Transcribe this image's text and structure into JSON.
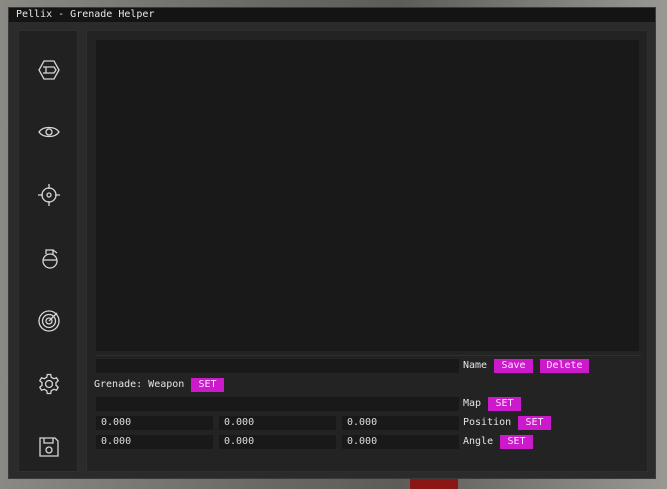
{
  "window": {
    "title": "Pellix - Grenade Helper"
  },
  "sidebar": {
    "items": [
      {
        "icon": "weapon-hexagon-icon"
      },
      {
        "icon": "eye-icon"
      },
      {
        "icon": "crosshair-icon"
      },
      {
        "icon": "grenade-icon"
      },
      {
        "icon": "radar-icon"
      },
      {
        "icon": "gear-icon"
      },
      {
        "icon": "floppy-disk-icon"
      }
    ]
  },
  "form": {
    "name": {
      "value": "",
      "label": "Name",
      "save": "Save",
      "delete": "Delete"
    },
    "grenade": {
      "label": "Grenade: Weapon",
      "set": "SET"
    },
    "map": {
      "value": "",
      "label": "Map",
      "set": "SET"
    },
    "position": {
      "x": "0.000",
      "y": "0.000",
      "z": "0.000",
      "label": "Position",
      "set": "SET"
    },
    "angle": {
      "x": "0.000",
      "y": "0.000",
      "z": "0.000",
      "label": "Angle",
      "set": "SET"
    }
  },
  "colors": {
    "accent": "#cc19cc",
    "panel": "#232323",
    "field": "#191919"
  }
}
